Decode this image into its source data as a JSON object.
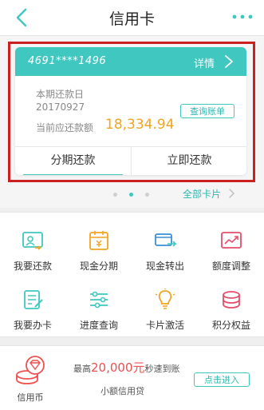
{
  "header": {
    "title": "信用卡"
  },
  "card": {
    "number": "4691****1496",
    "detail_label": "详情",
    "due_label": "本期还款日",
    "due_date": "20170927",
    "amount_label": "当前应还款额",
    "amount": "18,334.94",
    "query_label": "查询账单",
    "btn_installment": "分期还款",
    "btn_repay": "立即还款"
  },
  "pager": {
    "all_cards_label": "全部卡片"
  },
  "services": [
    {
      "label": "我要还款",
      "icon": "repay-icon"
    },
    {
      "label": "现金分期",
      "icon": "cash-installment-icon"
    },
    {
      "label": "现金转出",
      "icon": "cash-transfer-icon"
    },
    {
      "label": "额度调整",
      "icon": "limit-adjust-icon"
    },
    {
      "label": "我要办卡",
      "icon": "apply-card-icon"
    },
    {
      "label": "进度查询",
      "icon": "progress-query-icon"
    },
    {
      "label": "卡片激活",
      "icon": "card-activate-icon"
    },
    {
      "label": "积分权益",
      "icon": "points-benefit-icon"
    }
  ],
  "promo": {
    "name": "信用币",
    "prefix": "最高",
    "amount": "20,000元",
    "suffix": "秒速到账",
    "subtitle": "小额信用贷",
    "button": "点击进入"
  },
  "colors": {
    "accent": "#3fc7c0",
    "amount": "#f3a322",
    "promo_red": "#ef4f4f",
    "highlight_frame": "#cc1f1f"
  }
}
